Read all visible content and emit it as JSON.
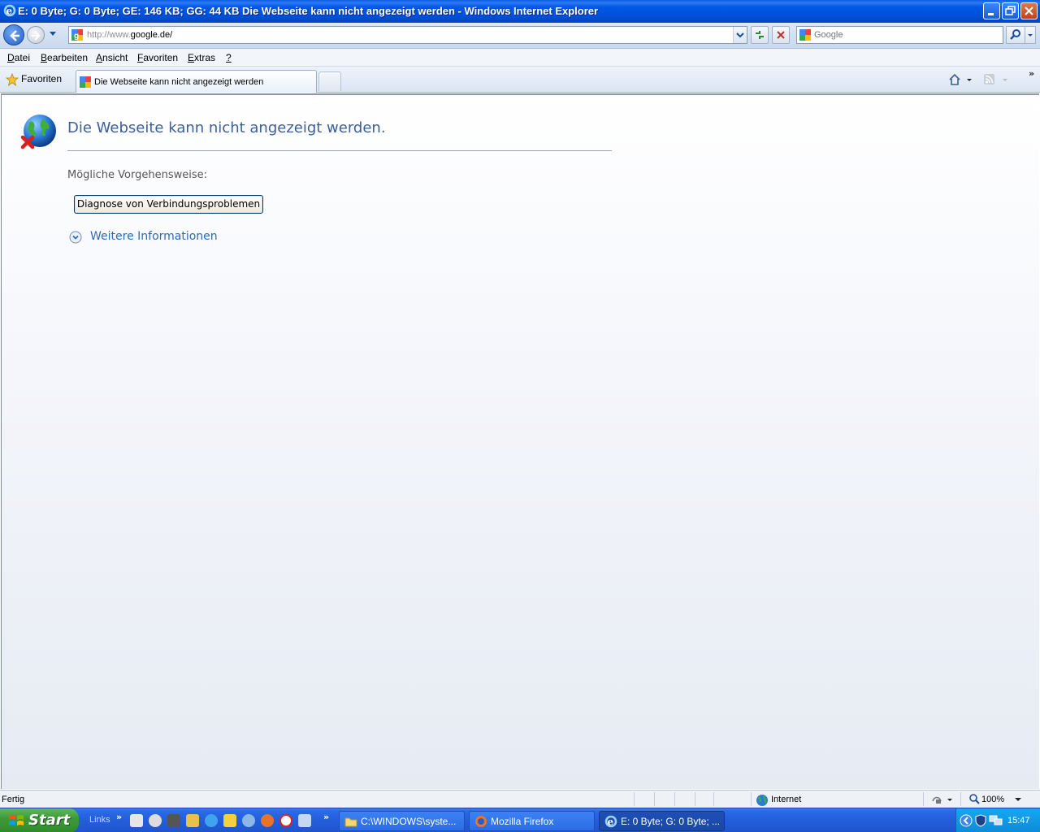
{
  "window": {
    "title": "E: 0 Byte; G: 0 Byte; GE: 146 KB; GG: 44 KB Die Webseite kann nicht angezeigt werden - Windows Internet Explorer"
  },
  "address": {
    "url_protocol": "http://www.",
    "url_host": "google.de/"
  },
  "search": {
    "placeholder": "Google"
  },
  "menu": {
    "items": [
      {
        "u": "D",
        "rest": "atei"
      },
      {
        "u": "B",
        "rest": "earbeiten"
      },
      {
        "u": "A",
        "rest": "nsicht"
      },
      {
        "u": "F",
        "rest": "avoriten"
      },
      {
        "u": "E",
        "rest": "xtras"
      },
      {
        "u": "?",
        "rest": ""
      }
    ]
  },
  "favorites_label": "Favoriten",
  "tab": {
    "label": "Die Webseite kann nicht angezeigt werden"
  },
  "content": {
    "title": "Die Webseite kann nicht angezeigt werden.",
    "subtitle": "Mögliche Vorgehensweise:",
    "diagnose_button": "Diagnose von Verbindungsproblemen",
    "more_info": "Weitere Informationen"
  },
  "status": {
    "text": "Fertig",
    "zone": "Internet",
    "zoom": "100%"
  },
  "taskbar": {
    "start": "Start",
    "links": "Links",
    "tasks": [
      {
        "label": "C:\\WINDOWS\\syste..."
      },
      {
        "label": "Mozilla Firefox"
      },
      {
        "label": "E: 0 Byte; G: 0 Byte; ..."
      }
    ],
    "clock": "15:47"
  },
  "colors": {
    "title_blue": "#0058e6",
    "error_title": "#3a5f9a",
    "link_blue": "#2e6ab6",
    "start_green": "#3d9a3a"
  }
}
